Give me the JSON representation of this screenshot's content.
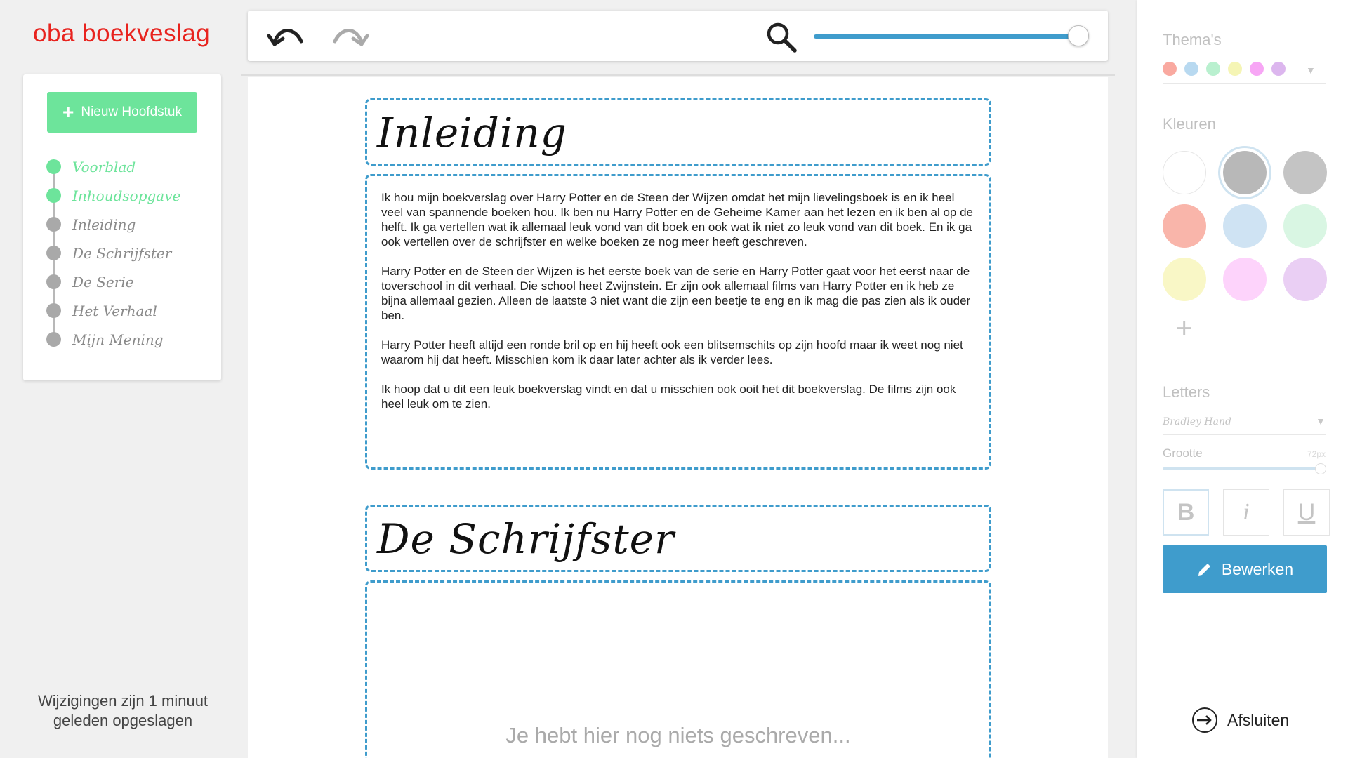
{
  "app": {
    "logo": "oba boekveslag"
  },
  "sidebar": {
    "new_chapter_label": "Nieuw Hoofdstuk",
    "chapters": [
      {
        "label": "Voorblad",
        "done": true
      },
      {
        "label": "Inhoudsopgave",
        "done": true
      },
      {
        "label": "Inleiding",
        "done": false
      },
      {
        "label": "De Schrijfster",
        "done": false
      },
      {
        "label": "De Serie",
        "done": false
      },
      {
        "label": "Het Verhaal",
        "done": false
      },
      {
        "label": "Mijn Mening",
        "done": false
      }
    ],
    "save_status": "Wijzigingen zijn 1 minuut geleden opgeslagen"
  },
  "toolbar": {
    "undo_icon": "undo-icon",
    "redo_icon": "redo-icon",
    "zoom_icon": "search-icon",
    "zoom_level": 1.0
  },
  "document": {
    "sections": [
      {
        "title": "Inleiding",
        "paragraphs": [
          "Ik hou mijn boekverslag over Harry Potter en de Steen der Wijzen omdat het mijn lievelingsboek is en ik heel veel van spannende boeken hou. Ik ben nu Harry Potter en de Geheime Kamer aan het lezen en ik ben al op de helft. Ik ga vertellen wat ik allemaal leuk vond van dit boek en ook wat ik niet zo leuk vond van dit boek. En ik ga ook vertellen over de schrijfster en welke boeken ze nog meer heeft geschreven.",
          "Harry Potter en de Steen der Wijzen is het eerste boek van de serie en Harry Potter gaat voor het eerst naar de toverschool in dit verhaal. Die school heet Zwijnstein. Er zijn ook allemaal films van Harry Potter en ik heb ze bijna allemaal gezien. Alleen de laatste 3 niet want die zijn een beetje te eng en ik mag die pas zien als ik ouder ben.",
          "Harry Potter heeft altijd een ronde bril op en hij heeft ook een blitsemschits op zijn hoofd maar ik weet nog niet waarom hij dat heeft. Misschien kom ik daar later achter als ik verder lees.",
          "Ik hoop dat u dit een leuk boekverslag vindt en dat u misschien ook ooit het dit boekverslag. De films zijn ook heel leuk om te zien."
        ]
      },
      {
        "title": "De Schrijfster",
        "placeholder": "Je hebt hier nog niets geschreven..."
      }
    ]
  },
  "panel": {
    "themes_title": "Thema's",
    "theme_colors": [
      "#f9a9a0",
      "#b8d9f0",
      "#b9f0cf",
      "#f5f5b5",
      "#f7a6f5",
      "#dcb6ee"
    ],
    "colors_title": "Kleuren",
    "colors": [
      "#ffffff",
      "#b8b8b8",
      "#c4c4c4",
      "#f9b5aa",
      "#cfe3f3",
      "#d9f6e3",
      "#f9f7c6",
      "#fdd3fb",
      "#eacff4"
    ],
    "selected_color_index": 1,
    "letters_title": "Letters",
    "font_value": "Bradley Hand",
    "size_label": "Grootte",
    "size_value": "72px",
    "bold_label": "B",
    "italic_label": "i",
    "underline_label": "U",
    "edit_label": "Bewerken",
    "close_label": "Afsluiten"
  }
}
